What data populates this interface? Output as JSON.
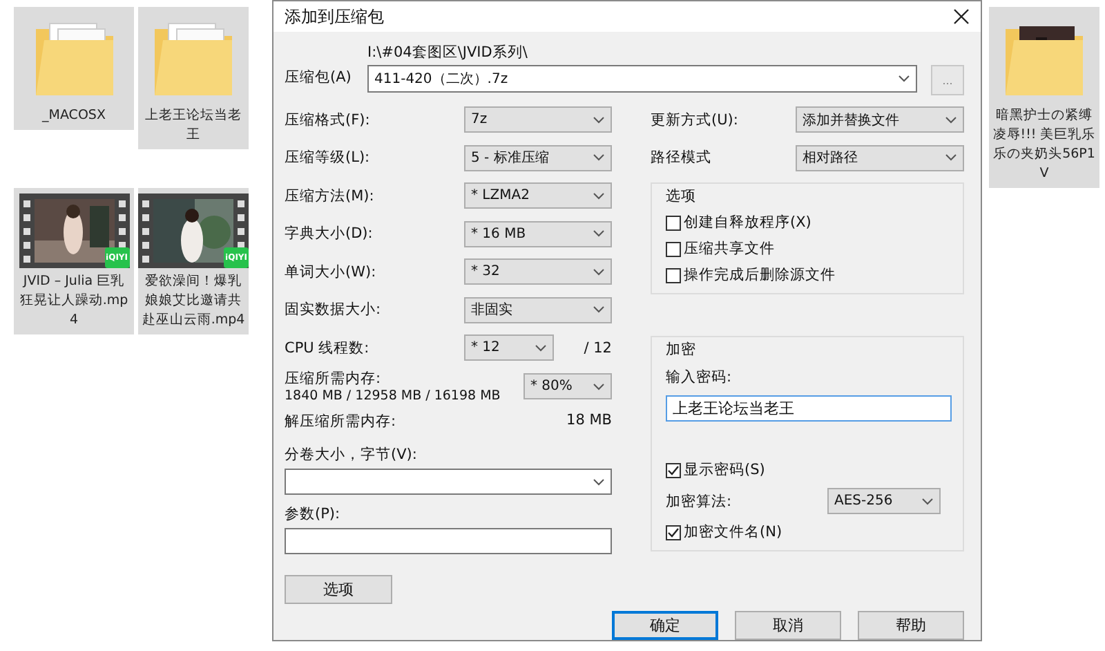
{
  "desktop": {
    "icons": [
      {
        "kind": "folder",
        "label": "_MACOSX",
        "selected": true
      },
      {
        "kind": "folder",
        "label": "上老王论坛当老王",
        "selected": true
      },
      {
        "kind": "video",
        "label": "JVID – Julia 巨乳狂晃让人躁动.mp4",
        "badge": "iQIYI",
        "selected": true
      },
      {
        "kind": "video",
        "label": "爱欲澡间！爆乳娘娘艾比邀请共赴巫山云雨.mp4",
        "badge": "iQIYI",
        "selected": true
      }
    ],
    "right_icons": [
      {
        "kind": "photo_folder",
        "label": "暗黑护士の紧缚凌辱!!! 美巨乳乐乐の夹奶头56P1V",
        "selected": true
      }
    ]
  },
  "dialog": {
    "title": "添加到压缩包",
    "archive": {
      "label": "压缩包(A)",
      "path": "I:\\#04套图区\\JVID系列\\",
      "value": "411-420（二次）.7z",
      "browse": "..."
    },
    "left": [
      {
        "kind": "combo",
        "label": "压缩格式(F):",
        "value": "7z",
        "editable": false
      },
      {
        "kind": "combo",
        "label": "压缩等级(L):",
        "value": "5 - 标准压缩",
        "editable": false
      },
      {
        "kind": "combo",
        "label": "压缩方法(M):",
        "value": "* LZMA2",
        "editable": false
      },
      {
        "kind": "combo",
        "label": "字典大小(D):",
        "value": "* 16 MB",
        "editable": false
      },
      {
        "kind": "combo",
        "label": "单词大小(W):",
        "value": "* 32",
        "editable": false
      },
      {
        "kind": "combo",
        "label": "固实数据大小:",
        "value": "非固实",
        "editable": false
      },
      {
        "kind": "threads",
        "label": "CPU 线程数:",
        "value": "* 12",
        "total": "/ 12",
        "editable": false
      },
      {
        "kind": "memory",
        "label": "压缩所需内存:",
        "detail": "1840 MB / 12958 MB / 16198 MB",
        "value": "* 80%",
        "editable": false
      },
      {
        "kind": "readout",
        "label": "解压缩所需内存:",
        "value": "18 MB"
      },
      {
        "kind": "stacked_combo",
        "label": "分卷大小，字节(V):",
        "editable": true
      },
      {
        "kind": "stacked_input",
        "label": "参数(P):"
      }
    ],
    "options_button": "选项",
    "right": {
      "update": {
        "label": "更新方式(U):",
        "value": "添加并替换文件",
        "editable": false
      },
      "path_mode": {
        "label": "路径模式",
        "value": "相对路径",
        "editable": false
      },
      "options": {
        "title": "选项",
        "checkboxes": [
          {
            "label": "创建自释放程序(X)",
            "checked": false
          },
          {
            "label": "压缩共享文件",
            "checked": false
          },
          {
            "label": "操作完成后删除源文件",
            "checked": false
          }
        ]
      },
      "encryption": {
        "title": "加密",
        "password_label": "输入密码:",
        "password": "上老王论坛当老王",
        "show_password": {
          "label": "显示密码(S)",
          "checked": true
        },
        "method": {
          "label": "加密算法:",
          "value": "AES-256",
          "editable": false
        },
        "encrypt_names": {
          "label": "加密文件名(N)",
          "checked": true
        }
      }
    },
    "buttons": [
      {
        "label": "确定",
        "default": true
      },
      {
        "label": "取消",
        "default": false
      },
      {
        "label": "帮助",
        "default": false
      }
    ]
  }
}
